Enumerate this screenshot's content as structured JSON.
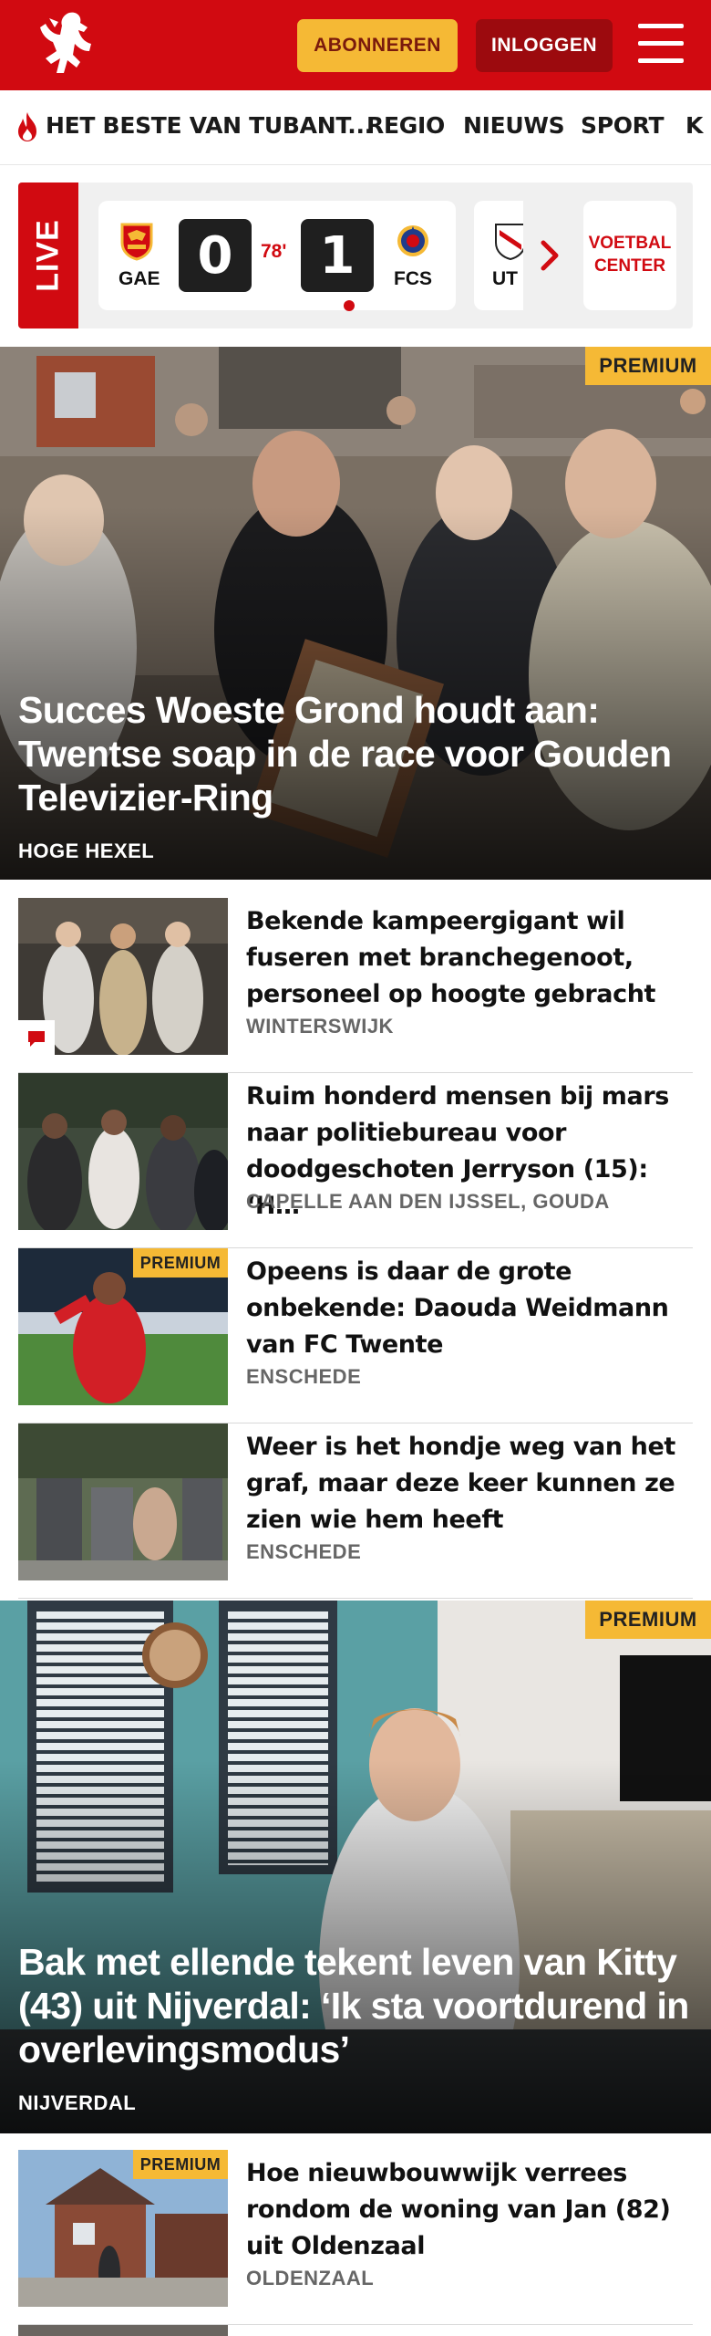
{
  "header": {
    "subscribe_label": "ABONNEREN",
    "login_label": "INLOGGEN",
    "brand_color": "#d10a11",
    "accent_color": "#f5b935"
  },
  "nav": {
    "items": [
      {
        "label": "HET BESTE VAN TUBANT..."
      },
      {
        "label": "REGIO"
      },
      {
        "label": "NIEUWS"
      },
      {
        "label": "SPORT"
      },
      {
        "label": "K"
      }
    ]
  },
  "live": {
    "label": "LIVE",
    "match": {
      "home": "GAE",
      "home_score": "0",
      "minute": "78'",
      "away_score": "1",
      "away": "FCS"
    },
    "next_team": "UT",
    "voetbal_center": "VOETBAL CENTER"
  },
  "hero1": {
    "premium": "PREMIUM",
    "title": "Succes Woeste Grond houdt aan: Twentse soap in de race voor Gouden Televizier-Ring",
    "location": "HOGE HEXEL"
  },
  "articles1": [
    {
      "title": "Bekende kampeergigant wil fuseren met branchegenoot, personeel op hoogte gebracht",
      "location": "WINTERSWIJK"
    },
    {
      "title": "Ruim honderd mensen bij mars naar politiebureau voor doodgeschoten Jerryson (15): ‘H…",
      "location": "CAPELLE AAN DEN IJSSEL, GOUDA"
    },
    {
      "title": "Opeens is daar de grote onbekende: Daouda Weidmann van FC Twente",
      "location": "ENSCHEDE",
      "premium": "PREMIUM"
    },
    {
      "title": "Weer is het hondje weg van het graf, maar deze keer kunnen ze zien wie hem heeft",
      "location": "ENSCHEDE"
    }
  ],
  "hero2": {
    "premium": "PREMIUM",
    "title": "Bak met ellende tekent leven van Kitty (43) uit Nijverdal: ‘Ik sta voortdu­rend in overlevingsmodus’",
    "location": "NIJVERDAL"
  },
  "articles2": [
    {
      "title": "Hoe nieuwbouwwijk verrees rondom de woning van Jan (82) uit Oldenzaal",
      "location": "OLDENZAAL",
      "premium": "PREMIUM"
    }
  ]
}
